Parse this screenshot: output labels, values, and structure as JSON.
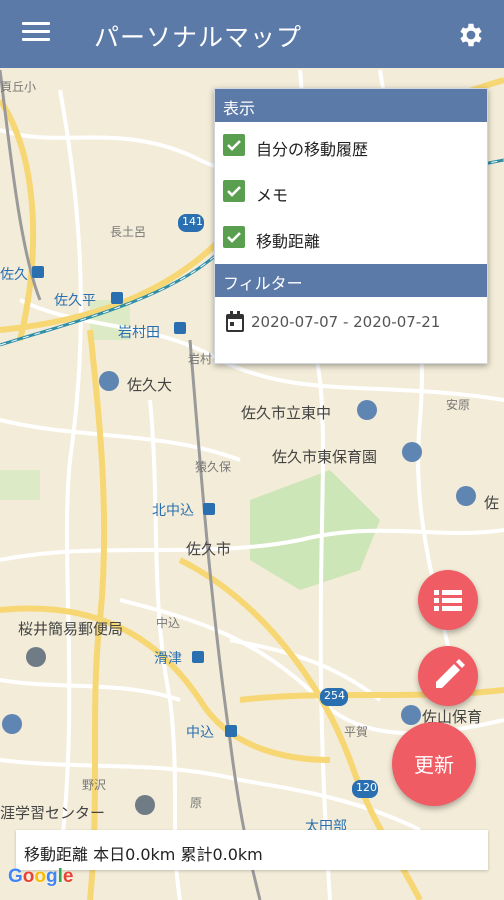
{
  "appbar": {
    "title": "パーソナルマップ",
    "menu_icon": "hamburger-menu-icon",
    "settings_icon": "gear-icon"
  },
  "display_panel": {
    "header": "表示",
    "options": [
      {
        "label": "自分の移動履歴",
        "checked": true
      },
      {
        "label": "メモ",
        "checked": true
      },
      {
        "label": "移動距離",
        "checked": true
      }
    ],
    "filter_header": "フィルター",
    "date_range": "2020-07-07 - 2020-07-21"
  },
  "map_labels": {
    "l1": "岩村田",
    "l2": "佐久大",
    "l3": "佐久市立東中",
    "l4": "佐久市東保育園",
    "l5": "北中込",
    "l6": "佐久市",
    "l7": "桜井簡易郵便局",
    "l8": "滑津",
    "l9": "中込",
    "l10": "涯学習センター",
    "l11": "佐久平",
    "l12": "長土呂",
    "l13": "佐",
    "l14": "安原",
    "l15": "猿久保",
    "l16": "平賀",
    "l17": "原",
    "l18": "太田部",
    "l19": "野沢",
    "l20": "岩村",
    "l21": "中込",
    "l22": "佐山保育",
    "l23": "岩村",
    "l24": "太田",
    "l25": "岩村田",
    "l26": "頁丘小",
    "l27": "佐久",
    "l28": "北中込",
    "road1": "141",
    "road2": "254",
    "road3": "120"
  },
  "fab": {
    "list_icon": "list-icon",
    "edit_icon": "pencil-icon",
    "update_label": "更新"
  },
  "status": {
    "text": "移動距離 本日0.0km 累計0.0km"
  },
  "attribution": {
    "g1": "G",
    "g2": "o",
    "g3": "o",
    "g4": "g",
    "g5": "l",
    "g6": "e"
  },
  "colors": {
    "appbar": "#5b7aa8",
    "fab": "#ef5c64",
    "checkbox": "#5a9e4f"
  }
}
